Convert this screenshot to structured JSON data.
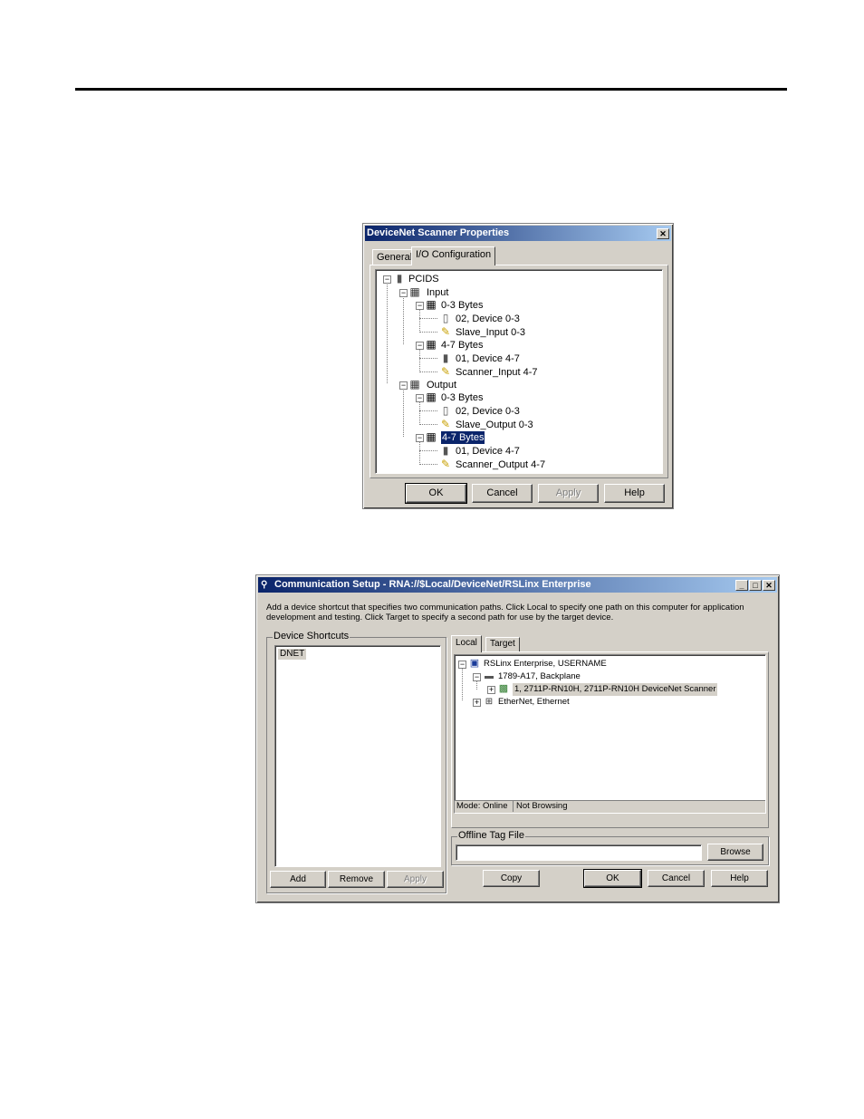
{
  "scanner_dialog": {
    "title": "DeviceNet Scanner Properties",
    "close_glyph": "✕",
    "tabs": [
      "General",
      "I/O Configuration"
    ],
    "tree": {
      "root": "PCIDS",
      "input": "Input",
      "input_03": "0-3 Bytes",
      "input_03_device": "02, Device 0-3",
      "input_03_tag": "Slave_Input 0-3",
      "input_47": "4-7 Bytes",
      "input_47_device": "01, Device 4-7",
      "input_47_tag": "Scanner_Input 4-7",
      "output": "Output",
      "output_03": "0-3 Bytes",
      "output_03_device": "02, Device 0-3",
      "output_03_tag": "Slave_Output 0-3",
      "output_47": "4-7 Bytes",
      "output_47_device": "01, Device 4-7",
      "output_47_tag": "Scanner_Output 4-7"
    },
    "buttons": {
      "ok": "OK",
      "cancel": "Cancel",
      "apply": "Apply",
      "help": "Help"
    }
  },
  "comm_dialog": {
    "title": "Communication Setup - RNA://$Local/DeviceNet/RSLinx Enterprise",
    "description": "Add a device shortcut that specifies two communication paths. Click Local to specify one path on this computer for application development and testing. Click Target to specify a second path for use by the target device.",
    "shortcuts_label": "Device Shortcuts",
    "shortcuts": [
      "DNET"
    ],
    "left_buttons": {
      "add": "Add",
      "remove": "Remove",
      "apply": "Apply"
    },
    "tabs": [
      "Local",
      "Target"
    ],
    "tree": {
      "root": "RSLinx Enterprise, USERNAME",
      "backplane": "1789-A17, Backplane",
      "scanner": "1, 2711P-RN10H, 2711P-RN10H DeviceNet Scanner",
      "ethernet": "EtherNet, Ethernet"
    },
    "status": {
      "mode": "Mode: Online",
      "browse": "Not Browsing"
    },
    "offline_label": "Offline Tag File",
    "offline_value": "",
    "browse": "Browse",
    "bottom_buttons": {
      "copy": "Copy",
      "ok": "OK",
      "cancel": "Cancel",
      "help": "Help"
    }
  }
}
